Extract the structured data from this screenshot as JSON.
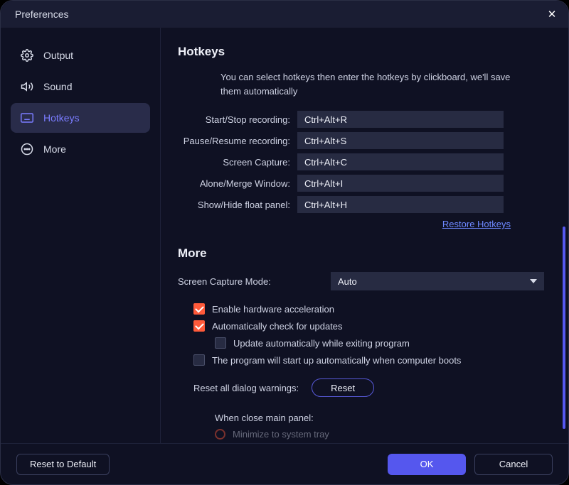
{
  "window": {
    "title": "Preferences"
  },
  "sidebar": {
    "items": [
      {
        "label": "Output"
      },
      {
        "label": "Sound"
      },
      {
        "label": "Hotkeys"
      },
      {
        "label": "More"
      }
    ]
  },
  "hotkeys": {
    "heading": "Hotkeys",
    "intro": "You can select hotkeys then enter the hotkeys by clickboard, we'll save them automatically",
    "rows": [
      {
        "label": "Start/Stop recording:",
        "value": "Ctrl+Alt+R"
      },
      {
        "label": "Pause/Resume recording:",
        "value": "Ctrl+Alt+S"
      },
      {
        "label": "Screen Capture:",
        "value": "Ctrl+Alt+C"
      },
      {
        "label": "Alone/Merge Window:",
        "value": "Ctrl+Alt+I"
      },
      {
        "label": "Show/Hide float panel:",
        "value": "Ctrl+Alt+H"
      }
    ],
    "restore_link": "Restore Hotkeys"
  },
  "more": {
    "heading": "More",
    "capture_mode_label": "Screen Capture Mode:",
    "capture_mode_value": "Auto",
    "options": {
      "hw_accel": "Enable hardware acceleration",
      "auto_update": "Automatically check for updates",
      "update_on_exit": "Update automatically while exiting program",
      "autostart": "The program will start up automatically when computer boots"
    },
    "reset_label": "Reset all dialog warnings:",
    "reset_button": "Reset",
    "close_panel_label": "When close main panel:",
    "close_panel_option": "Minimize to system tray"
  },
  "footer": {
    "reset_default": "Reset to Default",
    "ok": "OK",
    "cancel": "Cancel"
  }
}
